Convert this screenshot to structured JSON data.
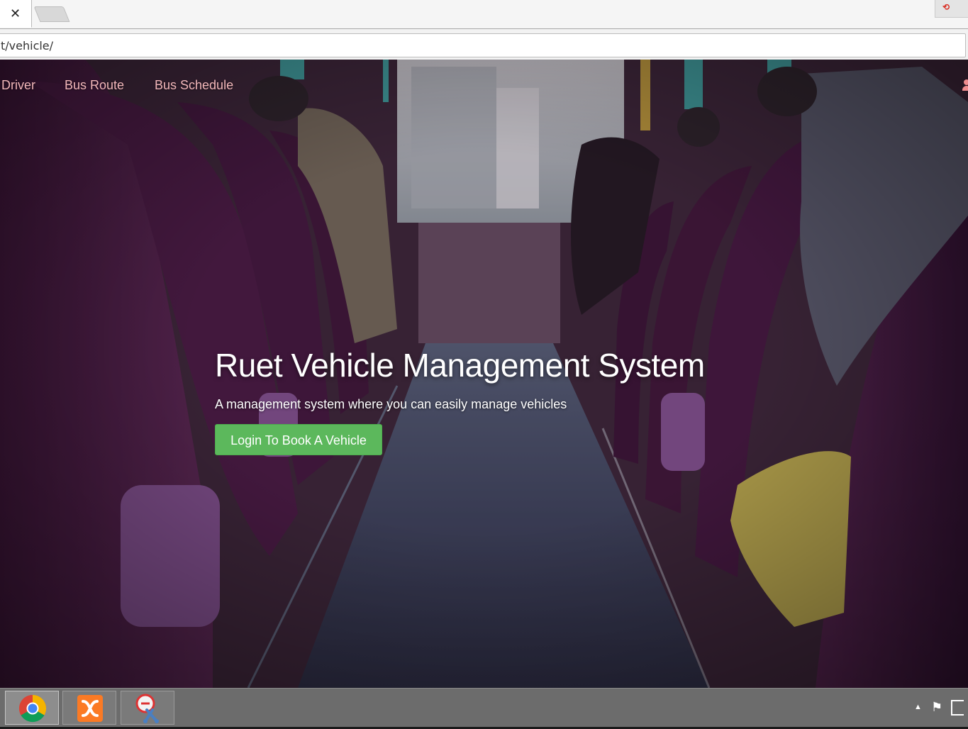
{
  "browser": {
    "tab_close_glyph": "✕",
    "address": "t/vehicle/",
    "extension_glyph": "⟲"
  },
  "nav": {
    "items": [
      {
        "label": "Driver"
      },
      {
        "label": "Bus Route"
      },
      {
        "label": "Bus Schedule"
      }
    ],
    "user_icon": "user-icon",
    "link_color": "#f2b7ba"
  },
  "hero": {
    "title": "Ruet Vehicle Management System",
    "subtitle": "A management system where you can easily manage vehicles",
    "cta_label": "Login To Book A Vehicle",
    "cta_color": "#5cb85c",
    "background": "bus-interior-photo"
  },
  "taskbar": {
    "apps": [
      {
        "name": "Google Chrome",
        "icon": "chrome-icon",
        "active": true
      },
      {
        "name": "XAMPP",
        "icon": "xampp-icon",
        "active": false
      },
      {
        "name": "Snipping Tool",
        "icon": "snipping-tool-icon",
        "active": false
      }
    ],
    "tray": {
      "show_hidden_glyph": "▲",
      "flag_glyph": "⚑"
    }
  }
}
